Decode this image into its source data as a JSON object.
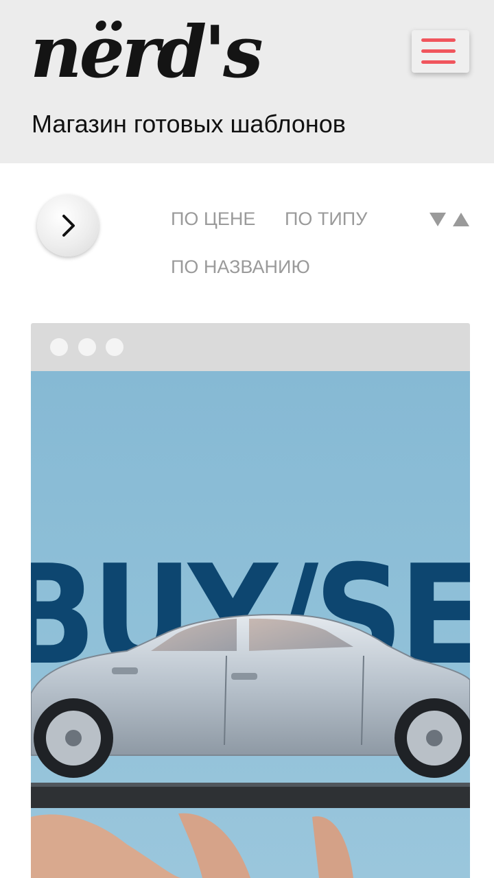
{
  "header": {
    "logo_text": "nërd's",
    "tagline": "Магазин готовых шаблонов",
    "menu_icon": "hamburger-icon",
    "menu_color": "#f0555d"
  },
  "sorting": {
    "arrow_icon": "chevron-right-icon",
    "options": [
      "по цене",
      "по типу",
      "по названию"
    ],
    "order_icons": [
      "sort-descending-icon",
      "sort-ascending-icon"
    ]
  },
  "card": {
    "window_dots": 3,
    "preview_headline": "BUY/SEL",
    "preview_bg": "#8fc0d8",
    "headline_color": "#0d4670"
  }
}
